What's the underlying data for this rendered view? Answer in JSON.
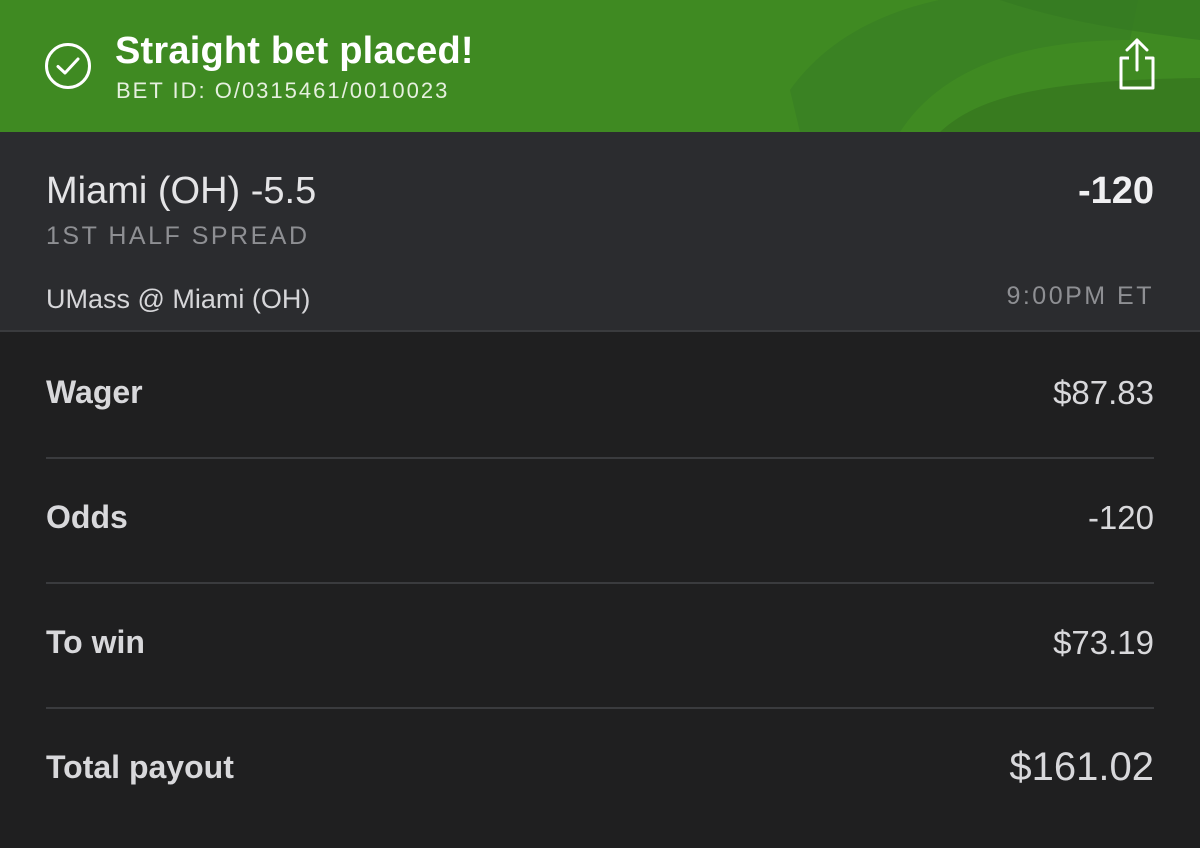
{
  "header": {
    "title": "Straight bet placed!",
    "bet_id": "BET ID: O/0315461/0010023",
    "status_icon": "check-circle-icon",
    "share_icon": "share-icon",
    "accent_color": "#3f8a22"
  },
  "selection": {
    "title": "Miami (OH) -5.5",
    "odds": "-120",
    "market": "1ST HALF SPREAD",
    "matchup": "UMass @ Miami (OH)",
    "time": "9:00PM ET"
  },
  "details": [
    {
      "label": "Wager",
      "value": "$87.83"
    },
    {
      "label": "Odds",
      "value": "-120"
    },
    {
      "label": "To win",
      "value": "$73.19"
    },
    {
      "label": "Total payout",
      "value": "$161.02"
    }
  ]
}
